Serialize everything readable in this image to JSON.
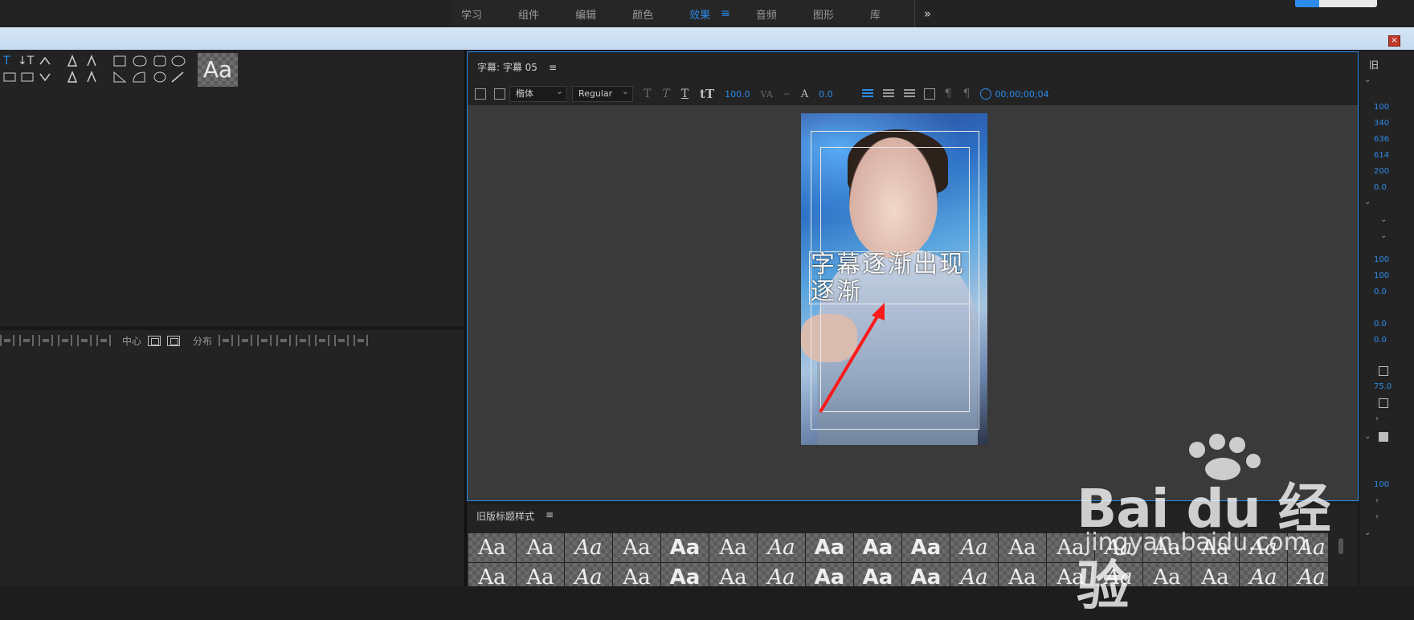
{
  "workspaces": {
    "tabs": [
      "学习",
      "组件",
      "编辑",
      "颜色",
      "效果",
      "音频",
      "图形",
      "库"
    ],
    "active": "效果",
    "menu_glyph": "≡",
    "more_glyph": "»"
  },
  "close_glyph": "×",
  "tools": {
    "type_tool": "T",
    "vertical_type_tool": "↓T",
    "style_swatch_label": "Aa"
  },
  "align": {
    "center_label": "中心",
    "distribute_label": "分布"
  },
  "title_panel": {
    "title": "字幕: 字幕 05",
    "menu_glyph": "≡",
    "font_family": "楷体",
    "font_style": "Regular",
    "font_size": "100.0",
    "leading_value": "0.0",
    "timecode": "00;00;00;04",
    "caption_text": "字幕逐渐出现逐渐"
  },
  "styles_panel": {
    "title": "旧版标题样式",
    "menu_glyph": "≡",
    "tile_label": "Aa",
    "tiles_row1": 18,
    "tiles_row2": 18
  },
  "right_panel": {
    "label": "旧",
    "values": [
      "100",
      "340",
      "636",
      "614",
      "200",
      "0.0",
      "100",
      "100",
      "0.0",
      "0.0",
      "0.0",
      "75.0",
      "100"
    ]
  },
  "watermark": {
    "main": "Bai du 经验",
    "sub": "jingyan.baidu.com"
  },
  "colors": {
    "accent": "#2d8ceb",
    "arrow": "#ff1a1a",
    "panel_bg": "#232323"
  }
}
